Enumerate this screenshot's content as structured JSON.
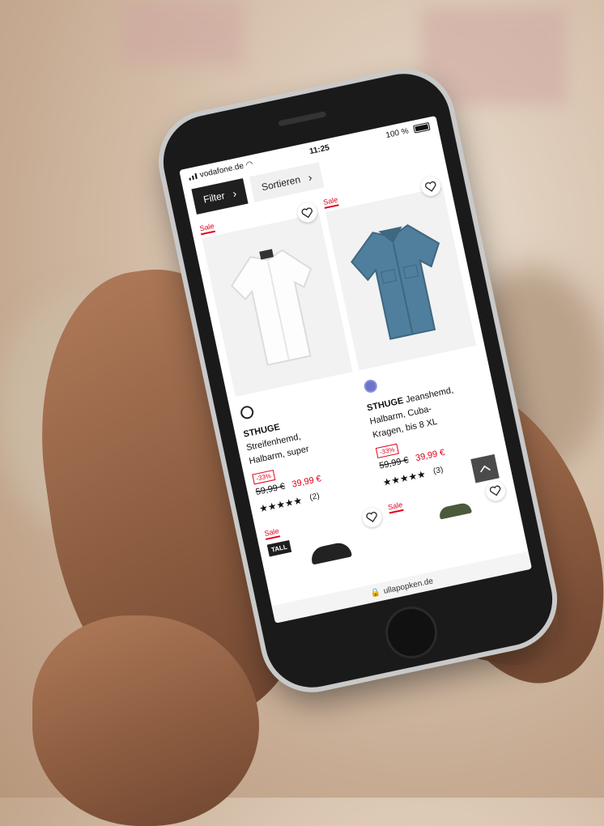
{
  "status_bar": {
    "carrier": "vodafone.de",
    "time": "11:25",
    "battery": "100 %"
  },
  "toolbar": {
    "filter_label": "Filter",
    "sort_label": "Sortieren"
  },
  "colors": {
    "sale_red": "#e2001a",
    "dark_button": "#1f1f1f"
  },
  "products": [
    {
      "sale_tag": "Sale",
      "swatch_color": "white",
      "brand": "STHUGE",
      "name_lines": [
        "Streifenhemd,",
        "Halbarm, super"
      ],
      "discount": "-33%",
      "old_price": "59,99 €",
      "new_price": "39,99 €",
      "stars": "★★★★★",
      "rating_count": "(2)",
      "image_icon": "white-shirt"
    },
    {
      "sale_tag": "Sale",
      "swatch_color": "blue",
      "brand": "STHUGE",
      "name_lines": [
        "Jeanshemd,",
        "Halbarm, Cuba-",
        "Kragen, bis 8 XL"
      ],
      "discount": "-33%",
      "old_price": "59,99 €",
      "new_price": "39,99 €",
      "stars": "★★★★★",
      "rating_count": "(3)",
      "image_icon": "denim-shirt"
    }
  ],
  "row2": {
    "sale_tag_left": "Sale",
    "sale_tag_right": "Sale",
    "tall_badge": "TALL"
  },
  "url_bar": {
    "domain": "ullapopken.de"
  }
}
